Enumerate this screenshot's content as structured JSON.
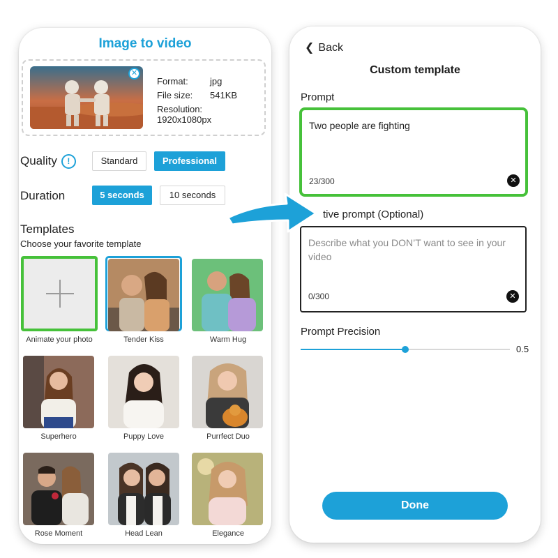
{
  "left_screen": {
    "title": "Image to video",
    "upload": {
      "format_label": "Format:",
      "format_value": "jpg",
      "size_label": "File size:",
      "size_value": "541KB",
      "resolution_label": "Resolution:",
      "resolution_value": "1920x1080px"
    },
    "quality": {
      "label": "Quality",
      "info_icon": "info-icon",
      "options": [
        "Standard",
        "Professional"
      ],
      "selected": "Professional"
    },
    "duration": {
      "label": "Duration",
      "options": [
        "5 seconds",
        "10 seconds"
      ],
      "selected": "5 seconds"
    },
    "templates": {
      "title": "Templates",
      "subtitle": "Choose your favorite template",
      "items": [
        {
          "label": "Animate your photo",
          "icon": "plus-icon"
        },
        {
          "label": "Tender Kiss"
        },
        {
          "label": "Warm Hug"
        },
        {
          "label": "Superhero"
        },
        {
          "label": "Puppy Love"
        },
        {
          "label": "Purrfect Duo"
        },
        {
          "label": "Rose Moment"
        },
        {
          "label": "Head Lean"
        },
        {
          "label": "Elegance"
        }
      ],
      "selected": "Tender Kiss"
    }
  },
  "right_screen": {
    "back_label": "Back",
    "back_icon": "chevron-left-icon",
    "title": "Custom template",
    "prompt": {
      "label": "Prompt",
      "value": "Two people are fighting",
      "counter": "23/300"
    },
    "negative_prompt": {
      "label_visible": "tive prompt (Optional)",
      "placeholder": "Describe what you DON’T want to see in your video",
      "counter": "0/300"
    },
    "precision": {
      "label": "Prompt Precision",
      "value": "0.5",
      "fraction": 0.5
    },
    "done_label": "Done"
  },
  "colors": {
    "accent": "#1da1d8",
    "highlight": "#46c13a"
  }
}
